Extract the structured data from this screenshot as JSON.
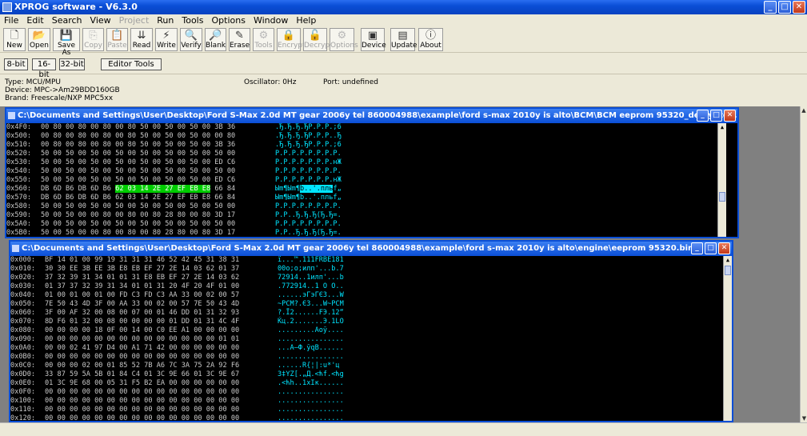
{
  "app": {
    "title": "XPROG software - V6.3.0"
  },
  "menu": [
    {
      "label": "File",
      "enabled": true
    },
    {
      "label": "Edit",
      "enabled": true
    },
    {
      "label": "Search",
      "enabled": true
    },
    {
      "label": "View",
      "enabled": true
    },
    {
      "label": "Project",
      "enabled": false
    },
    {
      "label": "Run",
      "enabled": true
    },
    {
      "label": "Tools",
      "enabled": true
    },
    {
      "label": "Options",
      "enabled": true
    },
    {
      "label": "Window",
      "enabled": true
    },
    {
      "label": "Help",
      "enabled": true
    }
  ],
  "toolbar": [
    {
      "label": "New",
      "icon": "new-file-icon",
      "glyph": "🗋",
      "enabled": true
    },
    {
      "label": "Open",
      "icon": "open-folder-icon",
      "glyph": "📂",
      "enabled": true
    },
    {
      "label": "Save As",
      "icon": "save-icon",
      "glyph": "💾",
      "enabled": true
    },
    {
      "label": "Copy",
      "icon": "copy-icon",
      "glyph": "⎘",
      "enabled": false
    },
    {
      "label": "Paste",
      "icon": "paste-icon",
      "glyph": "📋",
      "enabled": false
    },
    {
      "label": "Read",
      "icon": "read-chip-icon",
      "glyph": "⇊",
      "enabled": true
    },
    {
      "label": "Write",
      "icon": "write-bolt-icon",
      "glyph": "⚡",
      "enabled": true
    },
    {
      "label": "Verify",
      "icon": "verify-magnifier-icon",
      "glyph": "🔍",
      "enabled": true
    },
    {
      "label": "Blank",
      "icon": "blank-check-icon",
      "glyph": "🔎",
      "enabled": true
    },
    {
      "label": "Erase",
      "icon": "erase-brush-icon",
      "glyph": "✎",
      "enabled": true
    },
    {
      "label": "Tools",
      "icon": "tools-icon",
      "glyph": "⚙",
      "enabled": false
    },
    {
      "label": "Encrypt",
      "icon": "encrypt-lock-icon",
      "glyph": "🔒",
      "enabled": false
    },
    {
      "label": "Decrypt",
      "icon": "decrypt-lock-icon",
      "glyph": "🔓",
      "enabled": false
    },
    {
      "label": "Options",
      "icon": "options-icon",
      "glyph": "⚙",
      "enabled": false
    },
    {
      "label": "Device",
      "icon": "device-chip-icon",
      "glyph": "▣",
      "enabled": true
    },
    {
      "label": "Update",
      "icon": "update-icon",
      "glyph": "▤",
      "enabled": true
    },
    {
      "label": "About",
      "icon": "about-icon",
      "glyph": "ⓘ",
      "enabled": true
    }
  ],
  "view_buttons": [
    "8-bit",
    "16-bit",
    "32-bit"
  ],
  "editor_tools_label": "Editor Tools",
  "device_info": {
    "type": "Type: MCU/MPU",
    "device": "Device: MPC->Am29BDD160GB",
    "brand": "Brand: Freescale/NXP MPC5xx",
    "oscillator": "Oscillator: 0Hz",
    "port": "Port: undefined"
  },
  "window1": {
    "title": "C:\\Documents and Settings\\User\\Desktop\\Ford S-Max 2.0d MT gear 2006y tel  860004988\\example\\ford s-max 2010y is alto\\BCM\\BCM eeprom 95320_decrypted.BIN",
    "rows": [
      {
        "addr": "0x4F0:",
        "hex": "00 80 00 80 00 80 00 80 50 00 50 00 50 00 3B 36",
        "ascii": ".Ђ.Ђ.Ђ.ЂP.P.P.;6"
      },
      {
        "addr": "0x500:",
        "hex": "00 80 00 80 00 80 00 80 50 00 50 00 50 00 00 80",
        "ascii": ".Ђ.Ђ.Ђ.ЂP.P.P..Ђ"
      },
      {
        "addr": "0x510:",
        "hex": "00 80 00 80 00 80 00 80 50 00 50 00 50 00 3B 36",
        "ascii": ".Ђ.Ђ.Ђ.ЂP.P.P.;6"
      },
      {
        "addr": "0x520:",
        "hex": "50 00 50 00 50 00 50 00 50 00 50 00 50 00 50 00",
        "ascii": "P.P.P.P.P.P.P.P."
      },
      {
        "addr": "0x530:",
        "hex": "50 00 50 00 50 00 50 00 50 00 50 00 50 00 ED C6",
        "ascii": "P.P.P.P.P.P.P.нЖ"
      },
      {
        "addr": "0x540:",
        "hex": "50 00 50 00 50 00 50 00 50 00 50 00 50 00 50 00",
        "ascii": "P.P.P.P.P.P.P.P."
      },
      {
        "addr": "0x550:",
        "hex": "50 00 50 00 50 00 50 00 50 00 50 00 50 00 ED C6",
        "ascii": "P.P.P.P.P.P.P.нЖ"
      },
      {
        "addr": "0x560:",
        "hex": "DB 6D B6 DB 6D B6 62 03 14 2E 27 EF EB E8 66 84",
        "ascii": "Ыm¶Ыm¶b..'.пльf„",
        "hl_from": 6,
        "hl_to": 13
      },
      {
        "addr": "0x570:",
        "hex": "DB 6D B6 DB 6D B6 62 03 14 2E 27 EF EB E8 66 84",
        "ascii": "Ыm¶Ыm¶b..'.пльf„"
      },
      {
        "addr": "0x580:",
        "hex": "50 00 50 00 50 00 50 00 50 00 50 00 50 00 50 00",
        "ascii": "P.P.P.P.P.P.P.P."
      },
      {
        "addr": "0x590:",
        "hex": "50 00 50 00 00 80 00 80 00 80 28 80 00 80 3D 17",
        "ascii": "P.P..Ђ.Ђ.Ђ(Ђ.Ђ=."
      },
      {
        "addr": "0x5A0:",
        "hex": "50 00 50 00 50 00 50 00 50 00 50 00 50 00 50 00",
        "ascii": "P.P.P.P.P.P.P.P."
      },
      {
        "addr": "0x5B0:",
        "hex": "50 00 50 00 00 80 00 80 00 80 28 80 00 80 3D 17",
        "ascii": "P.P..Ђ.Ђ.Ђ(Ђ.Ђ=."
      }
    ]
  },
  "window2": {
    "title": "C:\\Documents and Settings\\User\\Desktop\\Ford S-Max 2.0d MT gear 2006y tel  860004988\\example\\ford s-max 2010y is alto\\engine\\eeprom 95320.bin",
    "rows": [
      {
        "addr": "0x000:",
        "hex": "BF 14 01 00 99 19 31 31 31 46 52 42 45 31 38 31",
        "ascii": "ї...™.111FRBE181"
      },
      {
        "addr": "0x010:",
        "hex": "30 30 EE 3B EE 3B E8 EB EF 27 2E 14 03 62 01 37",
        "ascii": "00о;о;илп'...b.7"
      },
      {
        "addr": "0x020:",
        "hex": "37 32 39 31 34 01 01 31 E8 EB EF 27 2E 14 03 62",
        "ascii": "72914..1илп'...b"
      },
      {
        "addr": "0x030:",
        "hex": "01 37 37 32 39 31 34 01 01 31 20 4F 20 4F 01 00",
        "ascii": ".772914..1 O O.."
      },
      {
        "addr": "0x040:",
        "hex": "01 00 01 00 01 00 FD C3 FD C3 AA 33 00 02 00 57",
        "ascii": "......эГэГЄ3...W"
      },
      {
        "addr": "0x050:",
        "hex": "7E 50 43 4D 3F 00 AA 33 00 02 00 57 7E 50 43 4D",
        "ascii": "~PCM?.Є3...W~PCM"
      },
      {
        "addr": "0x060:",
        "hex": "3F 00 AF 32 00 08 00 07 00 01 46 DD 01 31 32 93",
        "ascii": "?.Ї2......FЭ.12“"
      },
      {
        "addr": "0x070:",
        "hex": "8D F6 01 32 00 08 00 00 00 00 01 DD 01 31 4C 4F",
        "ascii": "Ќц.2.......Э.1LO"
      },
      {
        "addr": "0x080:",
        "hex": "00 00 00 00 18 0F 00 14 00 C0 EE A1 00 00 00 00",
        "ascii": ".........Аоў...."
      },
      {
        "addr": "0x090:",
        "hex": "00 00 00 00 00 00 00 00 00 00 00 00 00 00 01 01",
        "ascii": "................"
      },
      {
        "addr": "0x0A0:",
        "hex": "00 00 02 41 97 D4 00 A1 71 42 00 00 00 00 00 00",
        "ascii": "...A—Ф.ўqB......"
      },
      {
        "addr": "0x0B0:",
        "hex": "00 00 00 00 00 00 00 00 00 00 00 00 00 00 00 00",
        "ascii": "................"
      },
      {
        "addr": "0x0C0:",
        "hex": "00 00 00 02 00 01 85 52 7B A6 7C 3A 75 2A 92 F6",
        "ascii": "......R{¦|:u*'ц"
      },
      {
        "addr": "0x0D0:",
        "hex": "33 87 59 5A 5B 01 84 C4 01 3C 9E 66 01 3C 9E 67",
        "ascii": "3‡YZ[.„Д.<ћf.<ћg"
      },
      {
        "addr": "0x0E0:",
        "hex": "01 3C 9E 68 00 05 31 F5 B2 EA 00 00 00 00 00 00",
        "ascii": ".<ћh..1хІк......"
      },
      {
        "addr": "0x0F0:",
        "hex": "00 00 00 00 00 00 00 00 00 00 00 00 00 00 00 00",
        "ascii": "................"
      },
      {
        "addr": "0x100:",
        "hex": "00 00 00 00 00 00 00 00 00 00 00 00 00 00 00 00",
        "ascii": "................"
      },
      {
        "addr": "0x110:",
        "hex": "00 00 00 00 00 00 00 00 00 00 00 00 00 00 00 00",
        "ascii": "................"
      },
      {
        "addr": "0x120:",
        "hex": "00 00 00 00 00 00 00 00 00 00 00 00 00 00 00 00",
        "ascii": "................"
      }
    ]
  }
}
